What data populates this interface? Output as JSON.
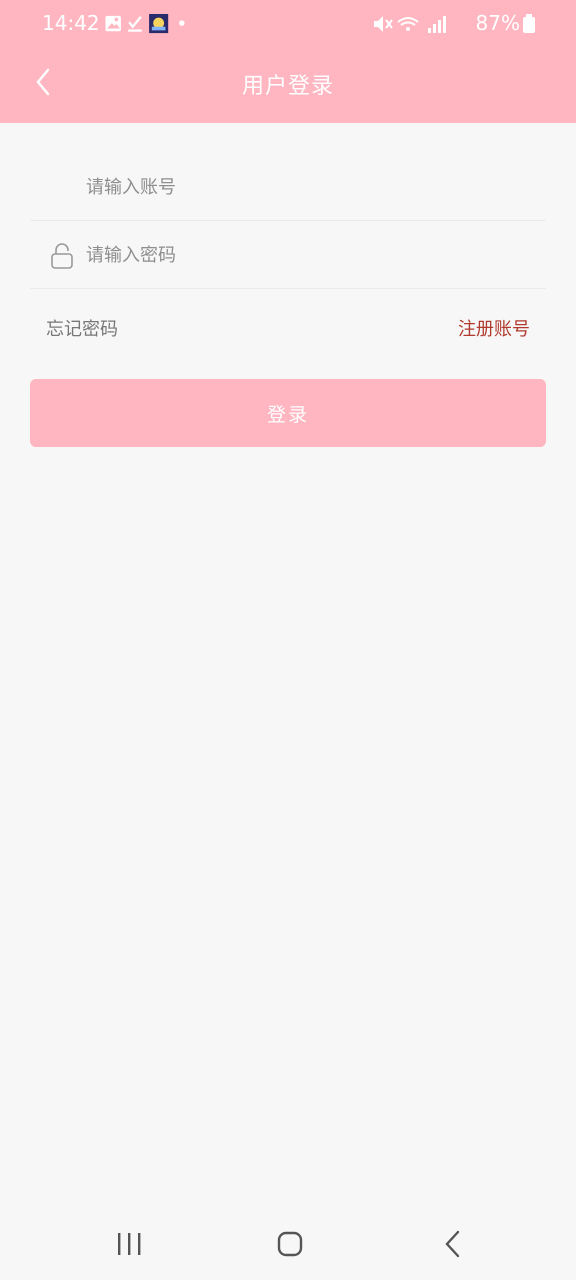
{
  "status": {
    "time": "14:42",
    "battery": "87%",
    "icons_left": [
      "image-icon",
      "check-icon",
      "app-avatar-icon",
      "dot-icon"
    ],
    "icons_right": [
      "mute-icon",
      "wifi-icon",
      "signal-icon",
      "battery-icon"
    ]
  },
  "header": {
    "title": "用户登录",
    "back_icon": "back-chevron-icon",
    "background_color": "#ffb6c1"
  },
  "form": {
    "account_placeholder": "请输入账号",
    "account_value": "",
    "password_placeholder": "请输入密码",
    "password_value": "",
    "password_icon": "lock-icon"
  },
  "links": {
    "forgot": "忘记密码",
    "register": "注册账号"
  },
  "login_button": {
    "label": "登录"
  },
  "colors": {
    "accent": "#ffb6c1",
    "register_link": "#b03a2e",
    "background": "#f7f7f7"
  },
  "system_nav": {
    "icons": [
      "recent-apps-icon",
      "home-icon",
      "back-icon"
    ]
  }
}
